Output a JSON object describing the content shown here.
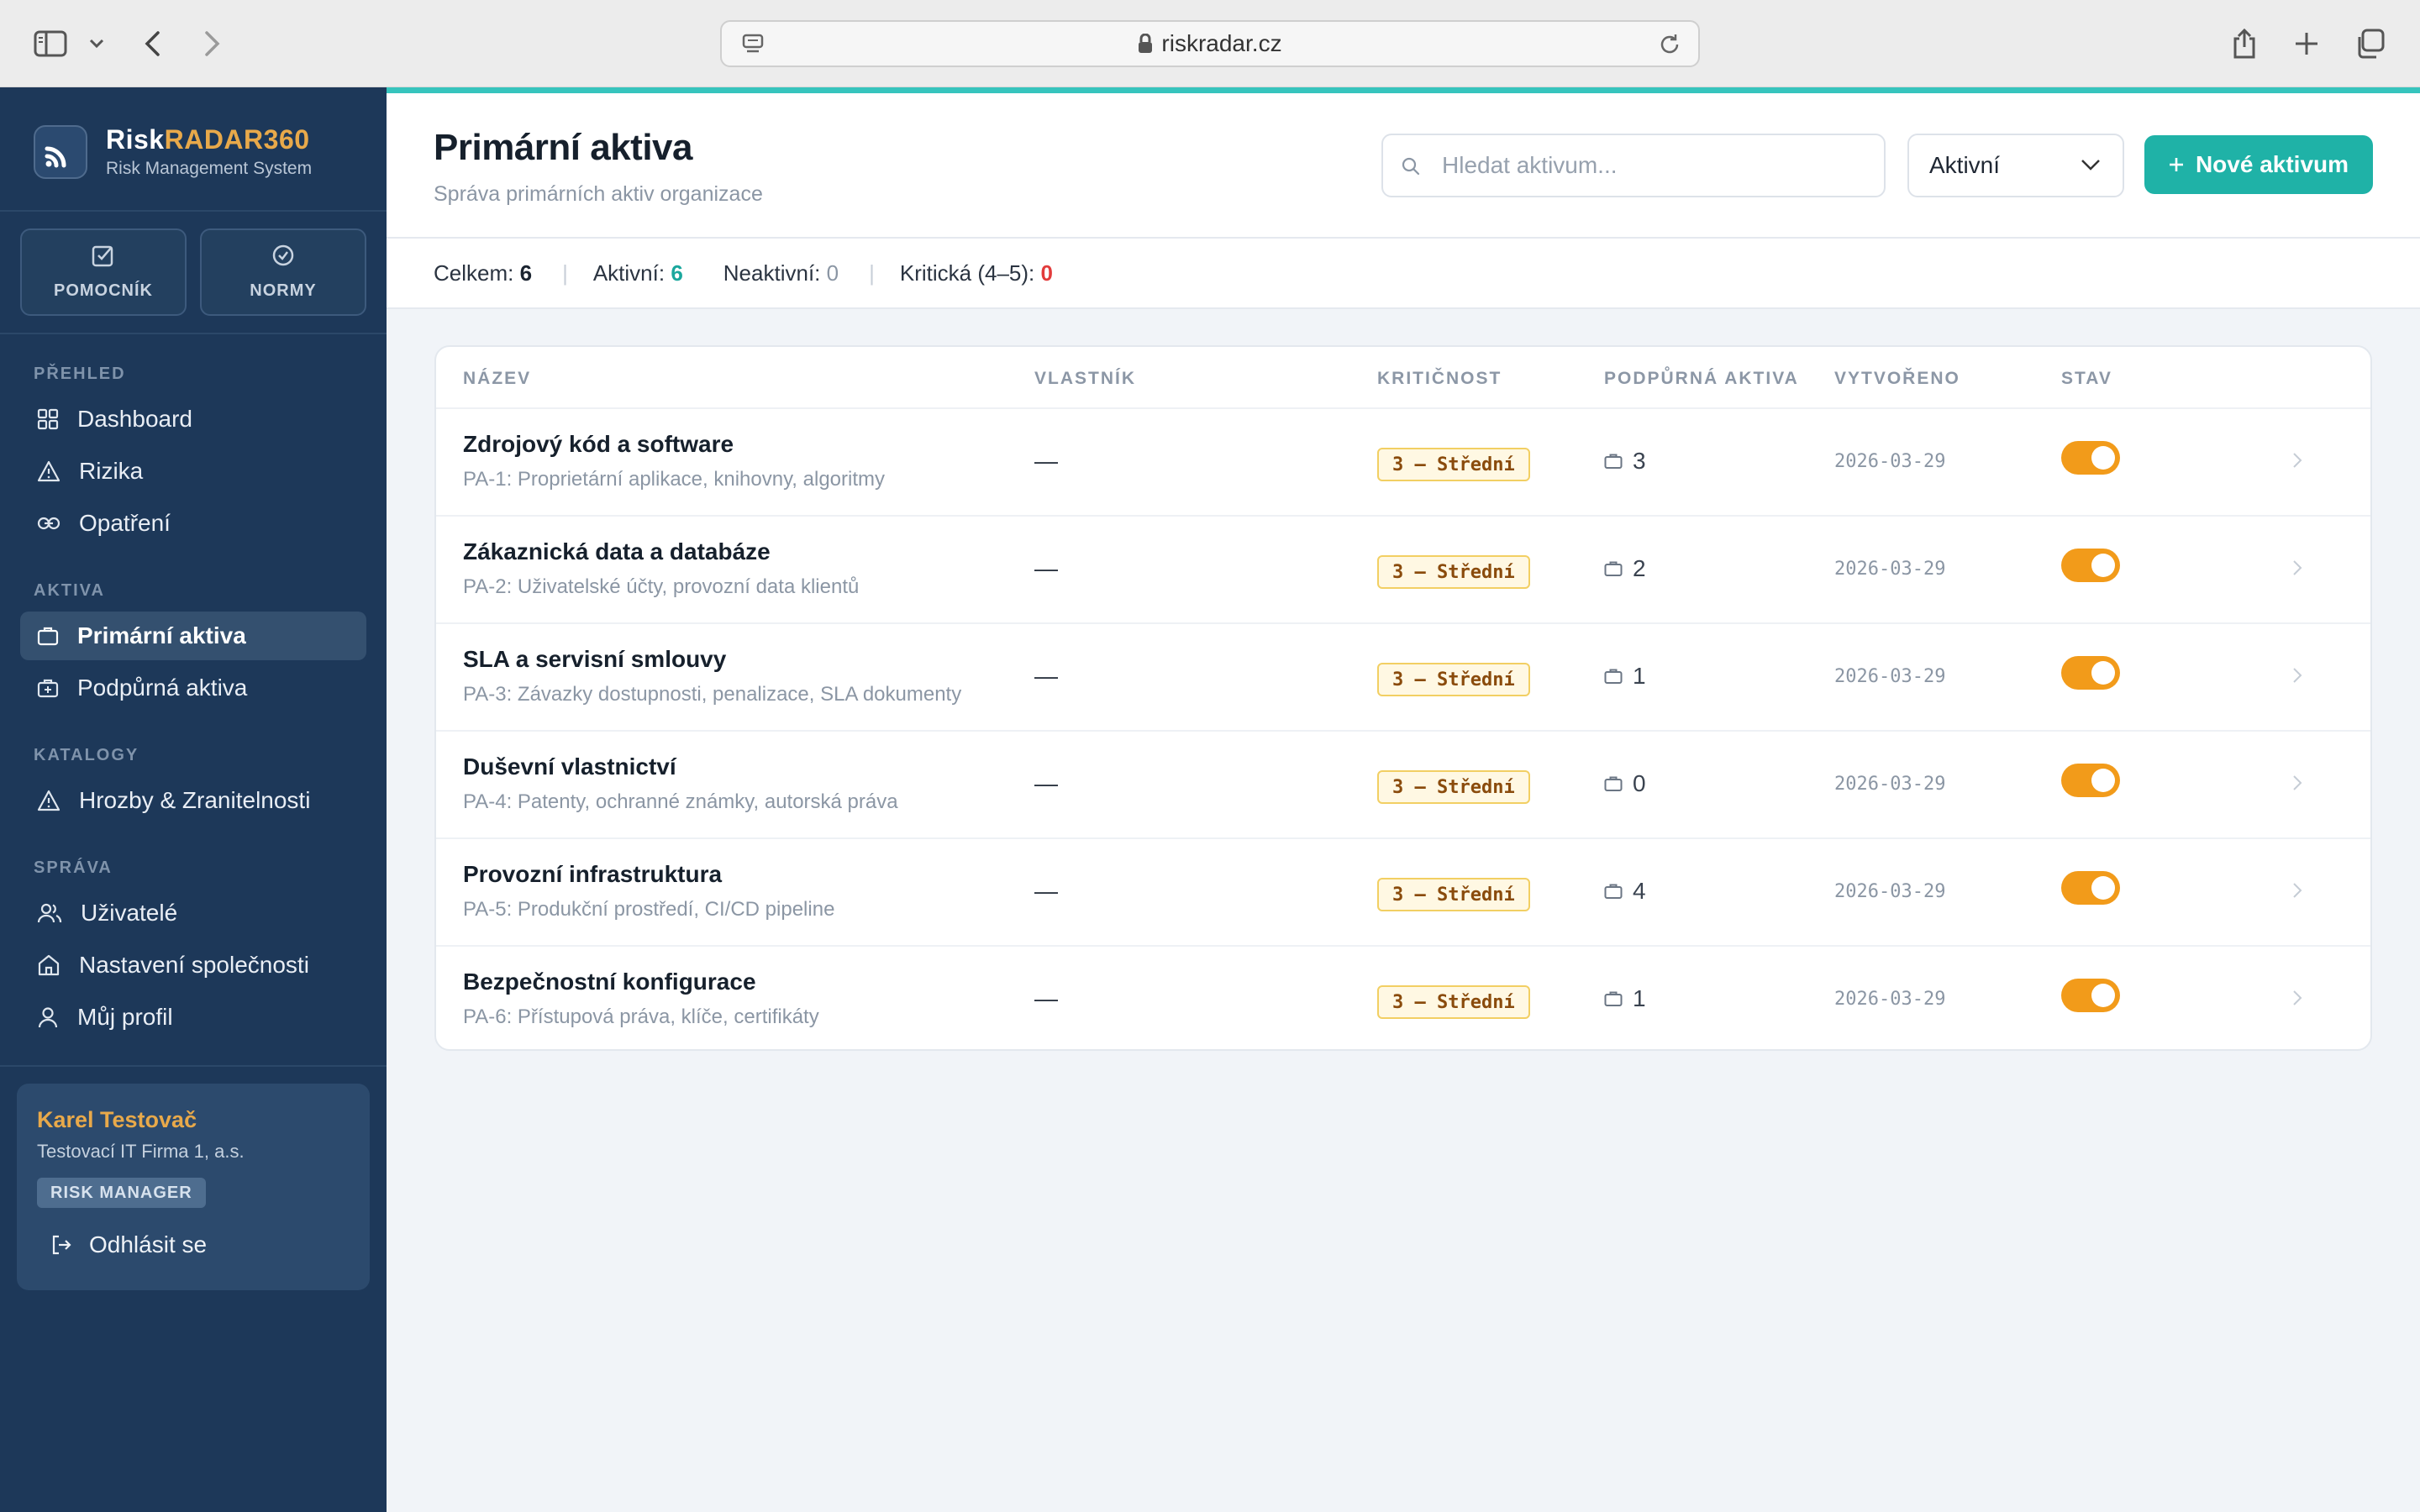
{
  "browser": {
    "url": "riskradar.cz"
  },
  "brand": {
    "name_part1": "Risk",
    "name_part2": "RADAR360",
    "subtitle": "Risk Management System",
    "accent_color": "#e8a94a"
  },
  "quick_actions": [
    {
      "label": "POMOCNÍK",
      "icon": "edit-check-icon"
    },
    {
      "label": "NORMY",
      "icon": "check-circle-icon"
    }
  ],
  "nav": {
    "sections": {
      "overview": "PŘEHLED",
      "assets": "AKTIVA",
      "catalogs": "KATALOGY",
      "admin": "SPRÁVA"
    },
    "items": {
      "dashboard": "Dashboard",
      "risks": "Rizika",
      "measures": "Opatření",
      "primary_assets": "Primární aktiva",
      "support_assets": "Podpůrná aktiva",
      "threats": "Hrozby & Zranitelnosti",
      "users": "Uživatelé",
      "company_settings": "Nastavení společnosti",
      "my_profile": "Můj profil"
    },
    "active": "primary_assets"
  },
  "user": {
    "name": "Karel Testovač",
    "company": "Testovací IT Firma 1, a.s.",
    "role": "RISK MANAGER",
    "logout_label": "Odhlásit se"
  },
  "page": {
    "title": "Primární aktiva",
    "subtitle": "Správa primárních aktiv organizace",
    "search_placeholder": "Hledat aktivum...",
    "filter_value": "Aktivní",
    "new_button_label": "Nové aktivum",
    "primary_color": "#1fb2a7"
  },
  "stats": {
    "total_label": "Celkem:",
    "total_value": "6",
    "active_label": "Aktivní:",
    "active_value": "6",
    "inactive_label": "Neaktivní:",
    "inactive_value": "0",
    "critical_label": "Kritická (4–5):",
    "critical_value": "0"
  },
  "table": {
    "columns": [
      "NÁZEV",
      "VLASTNÍK",
      "KRITIČNOST",
      "PODPŮRNÁ AKTIVA",
      "VYTVOŘENO",
      "STAV"
    ],
    "rows": [
      {
        "name": "Zdrojový kód a software",
        "desc": "PA-1: Proprietární aplikace, knihovny, algoritmy",
        "owner": "—",
        "criticality": "3 – Střední",
        "support_count": "3",
        "created": "2026-03-29",
        "active": true
      },
      {
        "name": "Zákaznická data a databáze",
        "desc": "PA-2: Uživatelské účty, provozní data klientů",
        "owner": "—",
        "criticality": "3 – Střední",
        "support_count": "2",
        "created": "2026-03-29",
        "active": true
      },
      {
        "name": "SLA a servisní smlouvy",
        "desc": "PA-3: Závazky dostupnosti, penalizace, SLA dokumenty",
        "owner": "—",
        "criticality": "3 – Střední",
        "support_count": "1",
        "created": "2026-03-29",
        "active": true
      },
      {
        "name": "Duševní vlastnictví",
        "desc": "PA-4: Patenty, ochranné známky, autorská práva",
        "owner": "—",
        "criticality": "3 – Střední",
        "support_count": "0",
        "created": "2026-03-29",
        "active": true
      },
      {
        "name": "Provozní infrastruktura",
        "desc": "PA-5: Produkční prostředí, CI/CD pipeline",
        "owner": "—",
        "criticality": "3 – Střední",
        "support_count": "4",
        "created": "2026-03-29",
        "active": true
      },
      {
        "name": "Bezpečnostní konfigurace",
        "desc": "PA-6: Přístupová práva, klíče, certifikáty",
        "owner": "—",
        "criticality": "3 – Střední",
        "support_count": "1",
        "created": "2026-03-29",
        "active": true
      }
    ]
  }
}
